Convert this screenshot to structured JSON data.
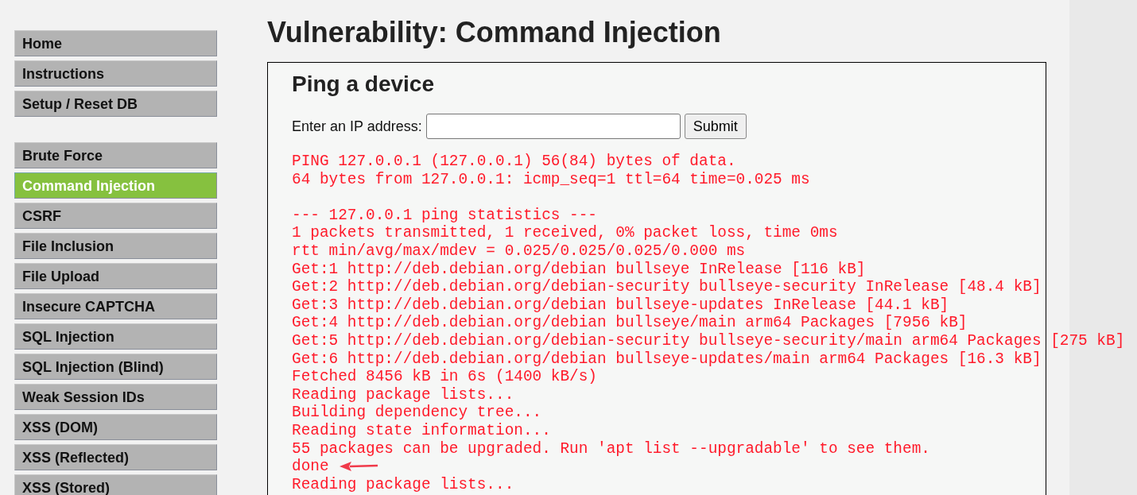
{
  "sidebar": {
    "groups": [
      [
        {
          "label": "Home",
          "selected": false
        },
        {
          "label": "Instructions",
          "selected": false
        },
        {
          "label": "Setup / Reset DB",
          "selected": false
        }
      ],
      [
        {
          "label": "Brute Force",
          "selected": false
        },
        {
          "label": "Command Injection",
          "selected": true
        },
        {
          "label": "CSRF",
          "selected": false
        },
        {
          "label": "File Inclusion",
          "selected": false
        },
        {
          "label": "File Upload",
          "selected": false
        },
        {
          "label": "Insecure CAPTCHA",
          "selected": false
        },
        {
          "label": "SQL Injection",
          "selected": false
        },
        {
          "label": "SQL Injection (Blind)",
          "selected": false
        },
        {
          "label": "Weak Session IDs",
          "selected": false
        },
        {
          "label": "XSS (DOM)",
          "selected": false
        },
        {
          "label": "XSS (Reflected)",
          "selected": false
        },
        {
          "label": "XSS (Stored)",
          "selected": false
        }
      ]
    ]
  },
  "page_title": "Vulnerability: Command Injection",
  "panel": {
    "heading": "Ping a device",
    "form": {
      "label": "Enter an IP address:",
      "button": "Submit"
    },
    "output_blocks": [
      [
        {
          "text": "PING 127.0.0.1 (127.0.0.1) 56(84) bytes of data.",
          "arrow": false
        },
        {
          "text": "64 bytes from 127.0.0.1: icmp_seq=1 ttl=64 time=0.025 ms",
          "arrow": false
        }
      ],
      [
        {
          "text": "--- 127.0.0.1 ping statistics ---",
          "arrow": false
        },
        {
          "text": "1 packets transmitted, 1 received, 0% packet loss, time 0ms",
          "arrow": false
        },
        {
          "text": "rtt min/avg/max/mdev = 0.025/0.025/0.025/0.000 ms",
          "arrow": false
        },
        {
          "text": "Get:1 http://deb.debian.org/debian bullseye InRelease [116 kB]",
          "arrow": false
        },
        {
          "text": "Get:2 http://deb.debian.org/debian-security bullseye-security InRelease [48.4 kB]",
          "arrow": false
        },
        {
          "text": "Get:3 http://deb.debian.org/debian bullseye-updates InRelease [44.1 kB]",
          "arrow": false
        },
        {
          "text": "Get:4 http://deb.debian.org/debian bullseye/main arm64 Packages [7956 kB]",
          "arrow": false
        },
        {
          "text": "Get:5 http://deb.debian.org/debian-security bullseye-security/main arm64 Packages [275 kB]",
          "arrow": false
        },
        {
          "text": "Get:6 http://deb.debian.org/debian bullseye-updates/main arm64 Packages [16.3 kB]",
          "arrow": false
        },
        {
          "text": "Fetched 8456 kB in 6s (1400 kB/s)",
          "arrow": false
        },
        {
          "text": "Reading package lists...",
          "arrow": false
        },
        {
          "text": "Building dependency tree...",
          "arrow": false
        },
        {
          "text": "Reading state information...",
          "arrow": false
        },
        {
          "text": "55 packages can be upgraded. Run 'apt list --upgradable' to see them.",
          "arrow": false
        },
        {
          "text": "done",
          "arrow": true
        },
        {
          "text": "Reading package lists...",
          "arrow": false
        }
      ]
    ]
  }
}
